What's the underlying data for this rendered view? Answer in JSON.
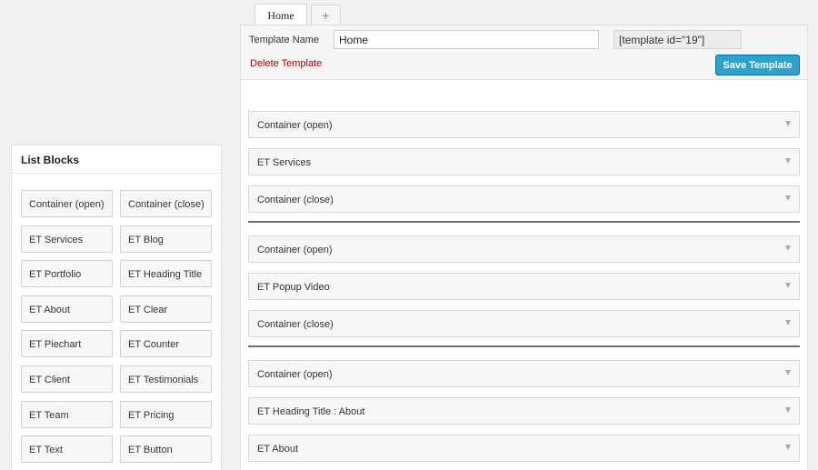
{
  "tabs": {
    "home": "Home",
    "add": "+"
  },
  "template": {
    "name_label": "Template Name",
    "name_value": "Home",
    "shortcode": "[template id=\"19\"]",
    "delete_label": "Delete Template",
    "save_label": "Save Template"
  },
  "list_blocks": {
    "title": "List Blocks",
    "items": [
      "Container (open)",
      "Container (close)",
      "ET Services",
      "ET Blog",
      "ET Portfolio",
      "ET Heading Title",
      "ET About",
      "ET Clear",
      "ET Piechart",
      "ET Counter",
      "ET Client",
      "ET Testimonials",
      "ET Team",
      "ET Pricing",
      "ET Text",
      "ET Button"
    ]
  },
  "builder": {
    "groups": [
      [
        "Container (open)",
        "ET Services",
        "Container (close)"
      ],
      [
        "Container (open)",
        "ET Popup Video",
        "Container (close)"
      ],
      [
        "Container (open)",
        "ET Heading Title : About",
        "ET About"
      ]
    ]
  },
  "colors": {
    "accent": "#2ea2cc",
    "delete": "#aa0000"
  },
  "icons": {
    "row_toggle": "chevron-down-icon"
  }
}
